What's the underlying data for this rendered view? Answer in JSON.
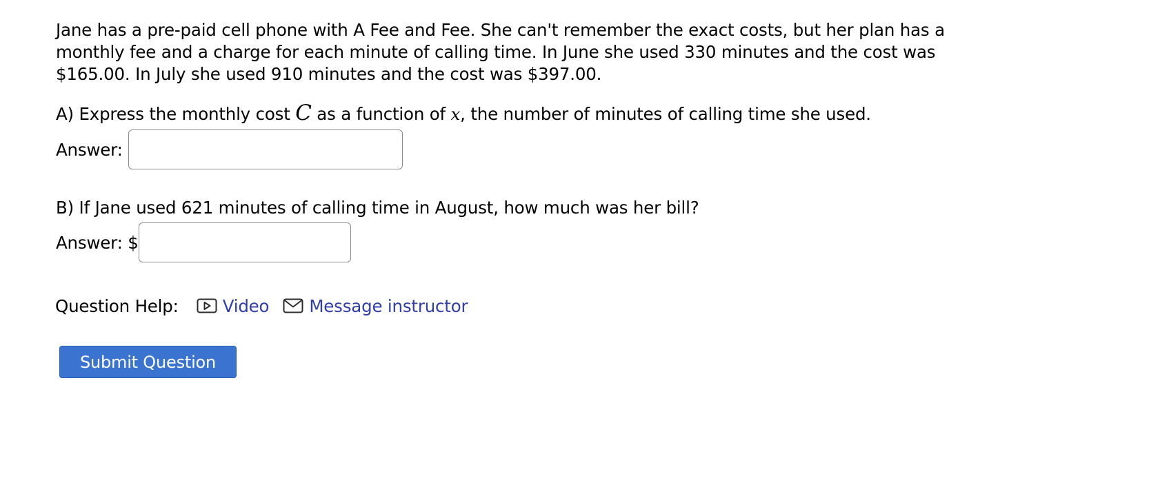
{
  "problem": {
    "text": "Jane has a pre-paid cell phone with A Fee and Fee. She can't remember the exact costs, but her plan has a monthly fee and a charge for each minute of calling time. In June she used 330 minutes and the cost was $165.00. In July she used 910 minutes and the cost was $397.00."
  },
  "part_a": {
    "prefix": "A) Express the monthly cost ",
    "var_c": "C",
    "middle": " as a function of ",
    "var_x": "x",
    "suffix": ", the number of minutes of calling time she used.",
    "answer_label": "Answer:",
    "answer_value": ""
  },
  "part_b": {
    "question": "B) If Jane used 621 minutes of calling time in August, how much was her bill?",
    "answer_label": "Answer: $",
    "answer_value": ""
  },
  "help": {
    "label": "Question Help:",
    "video_label": "Video",
    "message_label": "Message instructor",
    "link_color": "#2f3ea8"
  },
  "submit": {
    "label": "Submit Question",
    "color": "#3a74d0"
  }
}
